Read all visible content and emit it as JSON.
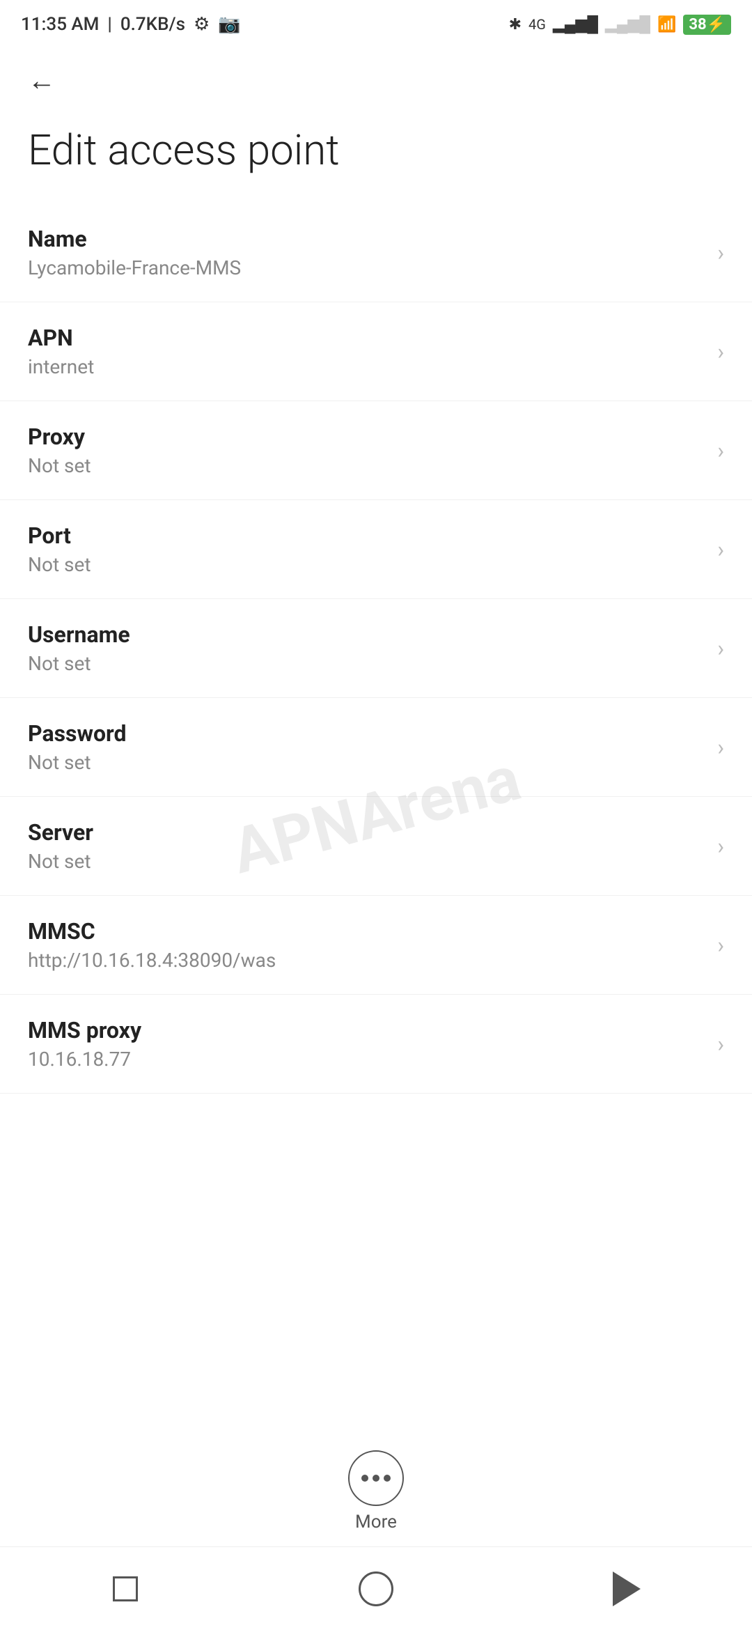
{
  "statusBar": {
    "time": "11:35 AM",
    "speed": "0.7KB/s",
    "battery": "38"
  },
  "header": {
    "backLabel": "←",
    "title": "Edit access point"
  },
  "settings": [
    {
      "id": "name",
      "label": "Name",
      "value": "Lycamobile-France-MMS"
    },
    {
      "id": "apn",
      "label": "APN",
      "value": "internet"
    },
    {
      "id": "proxy",
      "label": "Proxy",
      "value": "Not set"
    },
    {
      "id": "port",
      "label": "Port",
      "value": "Not set"
    },
    {
      "id": "username",
      "label": "Username",
      "value": "Not set"
    },
    {
      "id": "password",
      "label": "Password",
      "value": "Not set"
    },
    {
      "id": "server",
      "label": "Server",
      "value": "Not set"
    },
    {
      "id": "mmsc",
      "label": "MMSC",
      "value": "http://10.16.18.4:38090/was"
    },
    {
      "id": "mms-proxy",
      "label": "MMS proxy",
      "value": "10.16.18.77"
    }
  ],
  "more": {
    "label": "More"
  },
  "watermark": "APNArena"
}
